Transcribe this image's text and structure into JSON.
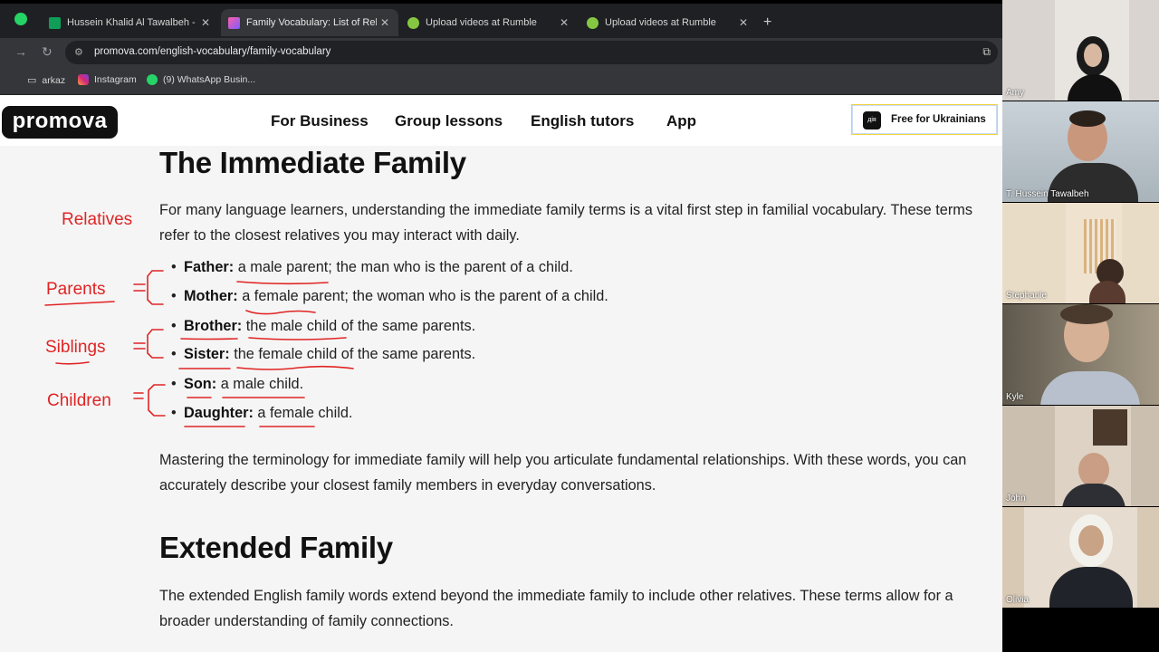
{
  "tabs": [
    {
      "title": "Hussein Khalid Al Tawalbeh - G",
      "icon": "sheets-icon",
      "color": "#0f9d58"
    },
    {
      "title": "Family Vocabulary: List of Relati",
      "icon": "promova-icon",
      "color": "#7b5cff",
      "active": true
    },
    {
      "title": "Upload videos at Rumble",
      "icon": "rumble-icon",
      "color": "#85c742"
    },
    {
      "title": "Upload videos at Rumble",
      "icon": "rumble-icon",
      "color": "#85c742"
    }
  ],
  "address": {
    "url": "promova.com/english-vocabulary/family-vocabulary"
  },
  "bookmarks": [
    {
      "label": "arkaz",
      "icon": "folder-icon"
    },
    {
      "label": "Instagram",
      "icon": "instagram-icon"
    },
    {
      "label": "(9) WhatsApp Busin...",
      "icon": "whatsapp-icon"
    }
  ],
  "site": {
    "logo": "promova",
    "nav": [
      "For Business",
      "Group lessons",
      "English tutors",
      "App"
    ],
    "ukraine_badge": "дія",
    "ukraine_cta": "Free for Ukrainians"
  },
  "article": {
    "h_immediate": "The Immediate Family",
    "p1": "For many language learners, understanding the immediate family terms is a vital first step in familial vocabulary. These terms refer to the closest relatives you may interact with daily.",
    "items": [
      {
        "term": "Father:",
        "def": "a male parent; the man who is the parent of a child."
      },
      {
        "term": "Mother:",
        "def": "a female parent; the woman who is the parent of a child."
      },
      {
        "term": "Brother:",
        "def": "the male child of the same parents."
      },
      {
        "term": "Sister:",
        "def": "the female child of the same parents."
      },
      {
        "term": "Son:",
        "def": "a male child."
      },
      {
        "term": "Daughter:",
        "def": "a female child."
      }
    ],
    "p2": "Mastering the terminology for immediate family will help you articulate fundamental relationships. With these words, you can accurately describe your closest family members in everyday conversations.",
    "h_extended": "Extended Family",
    "p3": "The extended English family words extend beyond the immediate family to include other relatives. These terms allow for a broader understanding of family connections."
  },
  "annotations": {
    "relatives": "Relatives",
    "parents": "Parents",
    "siblings": "Siblings",
    "children": "Children",
    "ink_color": "#e02424"
  },
  "participants": [
    {
      "name": "Amy"
    },
    {
      "name": "T. Hussein Tawalbeh"
    },
    {
      "name": "Stephanie"
    },
    {
      "name": "Kyle"
    },
    {
      "name": "John"
    },
    {
      "name": "Olivia"
    }
  ]
}
